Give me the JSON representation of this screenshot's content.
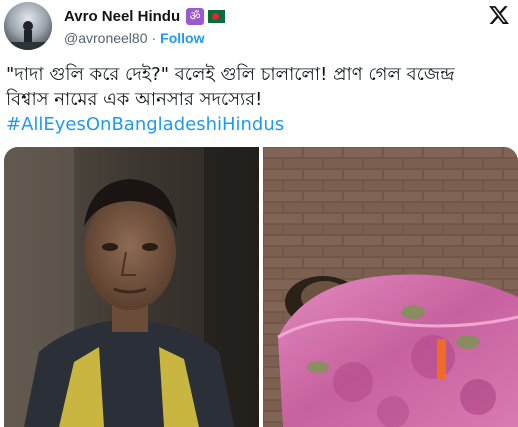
{
  "author": {
    "display_name": "Avro Neel Hindu",
    "om_badge": "ॐ",
    "handle": "@avroneel80",
    "separator": "·",
    "follow_label": "Follow"
  },
  "tweet": {
    "line1": "\"দাদা গুলি করে দেই?\" বলেই গুলি চালালো! প্রাণ গেল বজেন্দ্র",
    "line2": "বিশ্বাস নামের এক আনসার সদস্যের!",
    "hashtag": "#AllEyesOnBangladeshiHindus"
  },
  "colors": {
    "accent": "#1d9bf0",
    "text": "#0f1419",
    "muted": "#536471"
  },
  "icons": {
    "logo": "x-logo-icon",
    "flag": "bangladesh-flag-icon",
    "badge": "om-symbol-icon"
  }
}
